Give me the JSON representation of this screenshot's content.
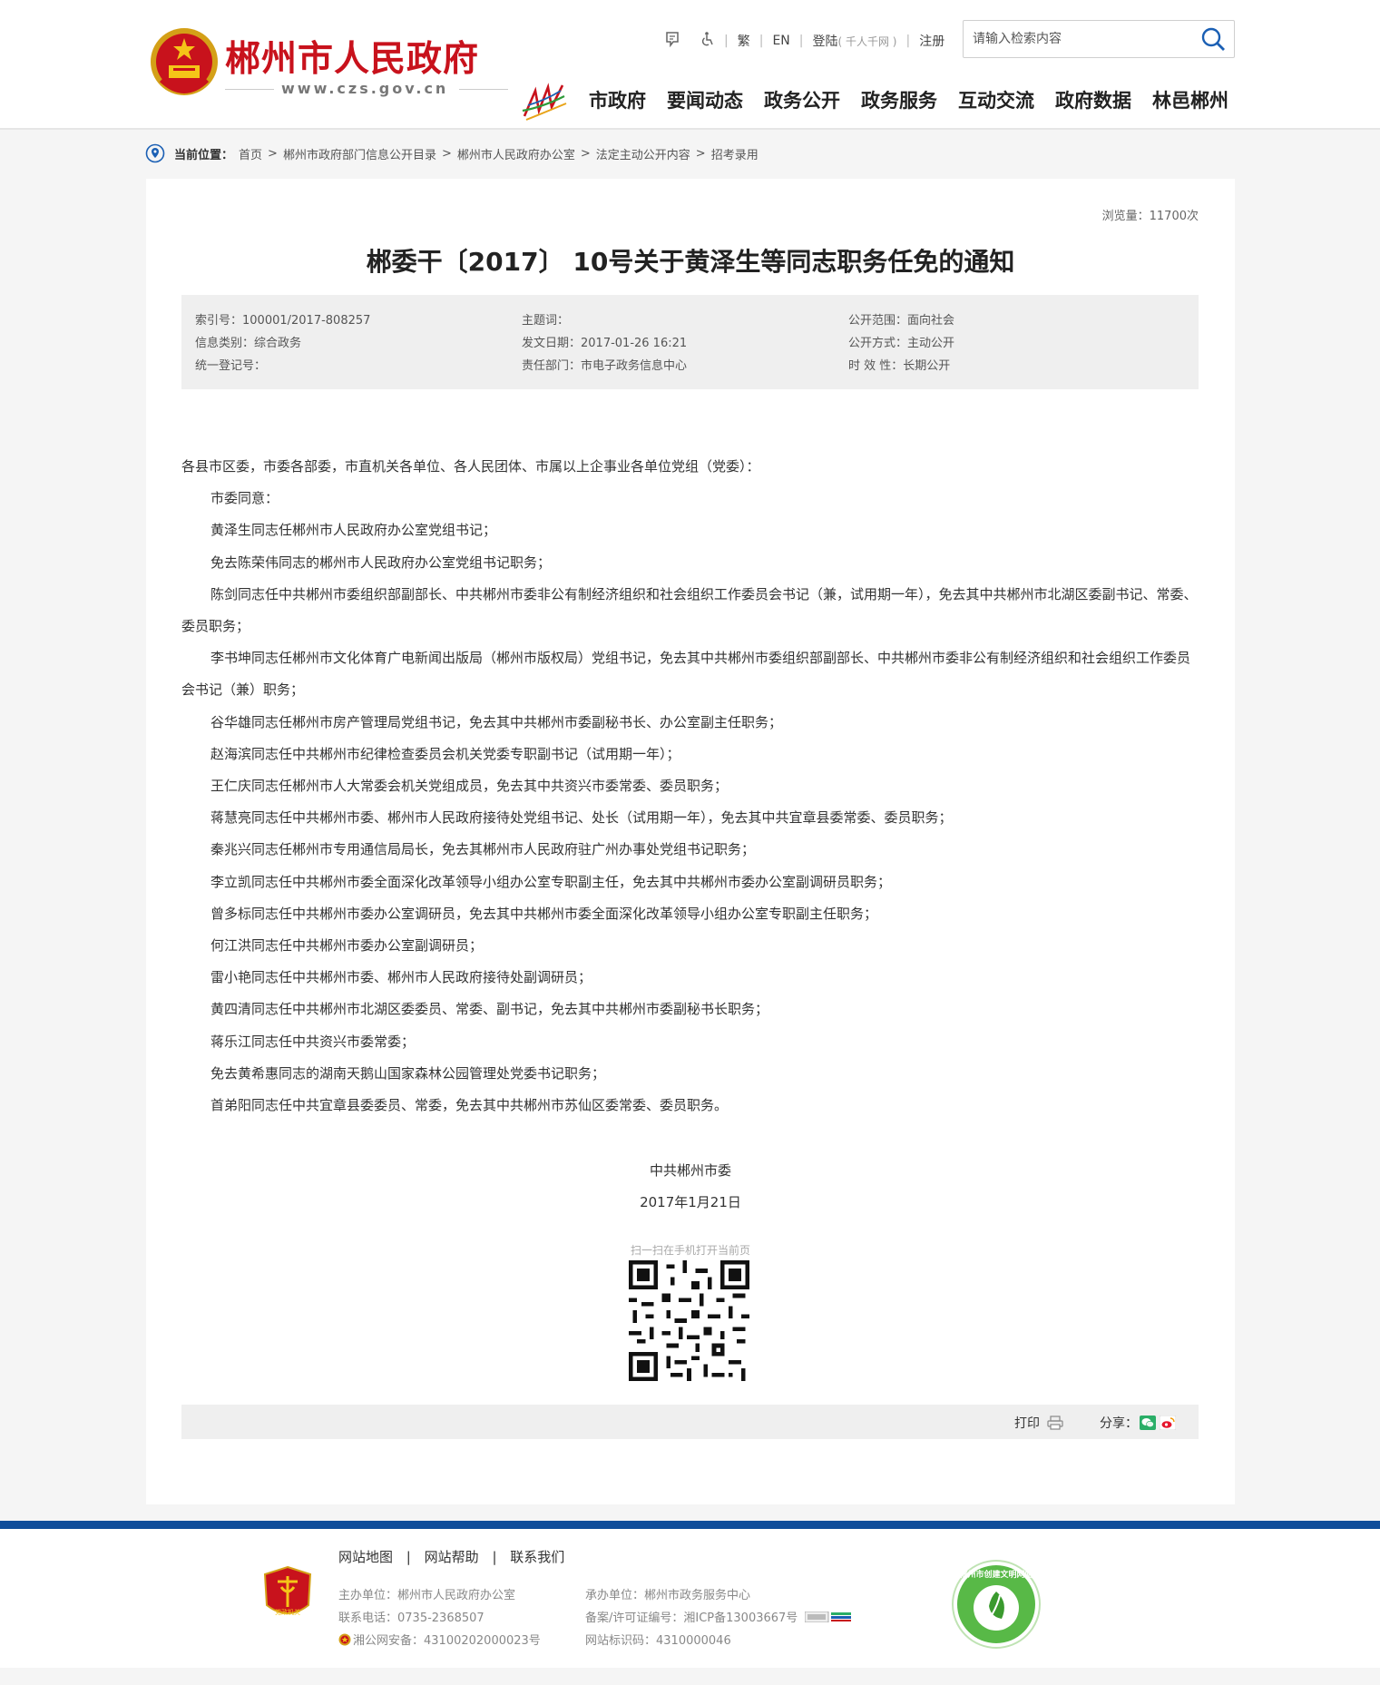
{
  "header": {
    "site_name": "郴州市人民政府",
    "site_url": "www.czs.gov.cn",
    "tools": {
      "accessibility_icon": "barrier-free-icon",
      "traditional": "繁",
      "english": "EN",
      "login": "登陆",
      "login_hint": "( 千人千网 )",
      "register": "注册"
    },
    "search": {
      "placeholder": "请输入检索内容"
    },
    "nav": [
      "市政府",
      "要闻动态",
      "政务公开",
      "政务服务",
      "互动交流",
      "政府数据",
      "林邑郴州"
    ]
  },
  "breadcrumb": {
    "label": "当前位置：",
    "items": [
      "首页",
      "郴州市政府部门信息公开目录",
      "郴州市人民政府办公室",
      "法定主动公开内容",
      "招考录用"
    ]
  },
  "article": {
    "views": "浏览量：11700次",
    "title": "郴委干〔2017〕 10号关于黄泽生等同志职务任免的通知",
    "meta": {
      "index_no": "索引号：100001/2017-808257",
      "category": "信息类别：综合政务",
      "reg_no": "统一登记号：",
      "subject": "主题词：",
      "date": "发文日期：2017-01-26 16:21",
      "dept": "责任部门：市电子政务信息中心",
      "scope": "公开范围：面向社会",
      "method": "公开方式：主动公开",
      "validity": "时 效 性：长期公开"
    },
    "paragraphs": [
      "各县市区委，市委各部委，市直机关各单位、各人民团体、市属以上企事业各单位党组（党委）：",
      "市委同意：",
      "黄泽生同志任郴州市人民政府办公室党组书记；",
      "免去陈荣伟同志的郴州市人民政府办公室党组书记职务；",
      "陈剑同志任中共郴州市委组织部副部长、中共郴州市委非公有制经济组织和社会组织工作委员会书记（兼，试用期一年），免去其中共郴州市北湖区委副书记、常委、委员职务；",
      "李书坤同志任郴州市文化体育广电新闻出版局（郴州市版权局）党组书记，免去其中共郴州市委组织部副部长、中共郴州市委非公有制经济组织和社会组织工作委员会书记（兼）职务；",
      "谷华雄同志任郴州市房产管理局党组书记，免去其中共郴州市委副秘书长、办公室副主任职务；",
      "赵海滨同志任中共郴州市纪律检查委员会机关党委专职副书记（试用期一年）；",
      "王仁庆同志任郴州市人大常委会机关党组成员，免去其中共资兴市委常委、委员职务；",
      "蒋慧亮同志任中共郴州市委、郴州市人民政府接待处党组书记、处长（试用期一年），免去其中共宜章县委常委、委员职务；",
      "秦兆兴同志任郴州市专用通信局局长，免去其郴州市人民政府驻广州办事处党组书记职务；",
      "李立凯同志任中共郴州市委全面深化改革领导小组办公室专职副主任，免去其中共郴州市委办公室副调研员职务；",
      "曾多标同志任中共郴州市委办公室调研员，免去其中共郴州市委全面深化改革领导小组办公室专职副主任职务；",
      "何江洪同志任中共郴州市委办公室副调研员；",
      "雷小艳同志任中共郴州市委、郴州市人民政府接待处副调研员；",
      "黄四清同志任中共郴州市北湖区委委员、常委、副书记，免去其中共郴州市委副秘书长职务；",
      "蒋乐江同志任中共资兴市委常委；",
      "免去黄希惠同志的湖南天鹅山国家森林公园管理处党委书记职务；",
      "首弟阳同志任中共宜章县委委员、常委，免去其中共郴州市苏仙区委常委、委员职务。"
    ],
    "signature": "中共郴州市委",
    "sign_date": "2017年1月21日",
    "qr_hint": "扫一扫在手机打开当前页",
    "print_label": "打印",
    "share_label": "分享："
  },
  "footer": {
    "links": [
      "网站地图",
      "网站帮助",
      "联系我们"
    ],
    "host": "主办单位：郴州市人民政府办公室",
    "phone": "联系电话：0735-2368507",
    "police": "湘公网安备：43100202000023号",
    "undertaker": "承办单位：郴州市政务服务中心",
    "icp": "备案/许可证编号：湘ICP备13003667号",
    "site_id": "网站标识码：4310000046",
    "badge_left_text": "党政机关",
    "badge_right_text": "郴州市创建文明网站"
  },
  "colors": {
    "brand_red": "#c8121c",
    "footer_blue": "#0f4d9a"
  }
}
